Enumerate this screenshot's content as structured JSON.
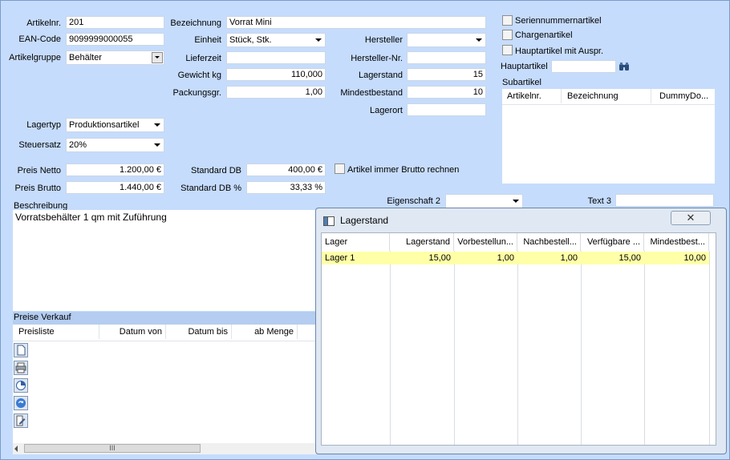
{
  "form": {
    "artikelnr": {
      "label": "Artikelnr.",
      "value": "201"
    },
    "ean": {
      "label": "EAN-Code",
      "value": "9099999000055"
    },
    "artikelgruppe": {
      "label": "Artikelgruppe",
      "value": "Behälter"
    },
    "bezeichnung": {
      "label": "Bezeichnung",
      "value": "Vorrat Mini"
    },
    "einheit": {
      "label": "Einheit",
      "value": "Stück, Stk."
    },
    "lieferzeit": {
      "label": "Lieferzeit",
      "value": ""
    },
    "gewicht": {
      "label": "Gewicht kg",
      "value": "110,000"
    },
    "packungsgr": {
      "label": "Packungsgr.",
      "value": "1,00"
    },
    "hersteller": {
      "label": "Hersteller",
      "value": ""
    },
    "herstellernr": {
      "label": "Hersteller-Nr.",
      "value": ""
    },
    "lagerstand": {
      "label": "Lagerstand",
      "value": "15"
    },
    "mindestbestand": {
      "label": "Mindestbestand",
      "value": "10"
    },
    "lagerort": {
      "label": "Lagerort",
      "value": ""
    },
    "lagertyp": {
      "label": "Lagertyp",
      "value": "Produktionsartikel"
    },
    "steuersatz": {
      "label": "Steuersatz",
      "value": "20%"
    },
    "preis_netto": {
      "label": "Preis Netto",
      "value": "1.200,00 €"
    },
    "preis_brutto": {
      "label": "Preis Brutto",
      "value": "1.440,00 €"
    },
    "standard_db": {
      "label": "Standard DB",
      "value": "400,00 €"
    },
    "standard_db_pct": {
      "label": "Standard DB %",
      "value": "33,33 %"
    },
    "brutto_rechnen": {
      "label": "Artikel immer Brutto rechnen",
      "checked": false
    },
    "eigenschaft2": {
      "label": "Eigenschaft 2",
      "value": ""
    },
    "text3": {
      "label": "Text 3",
      "value": ""
    },
    "beschreibung": {
      "label": "Beschreibung",
      "value": "Vorratsbehälter 1 qm mit Zuführung"
    }
  },
  "options": {
    "seriennummer": {
      "label": "Seriennummernartikel",
      "checked": false
    },
    "charge": {
      "label": "Chargenartikel",
      "checked": false
    },
    "hauptartikel_auspr": {
      "label": "Hauptartikel mit Auspr.",
      "checked": false
    },
    "hauptartikel": {
      "label": "Hauptartikel",
      "value": ""
    },
    "subartikel": {
      "label": "Subartikel",
      "columns": [
        "Artikelnr.",
        "Bezeichnung",
        "DummyDo..."
      ]
    }
  },
  "preise": {
    "title": "Preise Verkauf",
    "columns": [
      "Preisliste",
      "Datum von",
      "Datum bis",
      "ab Menge"
    ],
    "scroll_grip": "III"
  },
  "dialog": {
    "title": "Lagerstand",
    "close_glyph": "✕",
    "columns": [
      "Lager",
      "Lagerstand",
      "Vorbestellun...",
      "Nachbestell...",
      "Verfügbare ...",
      "Mindestbest..."
    ],
    "rows": [
      {
        "lager": "Lager 1",
        "lagerstand": "15,00",
        "vorbestellung": "1,00",
        "nachbestellung": "1,00",
        "verfuegbar": "15,00",
        "mindestbestand": "10,00"
      }
    ]
  },
  "colors": {
    "background": "#c6dcfc",
    "highlight_row": "#ffffa8"
  }
}
